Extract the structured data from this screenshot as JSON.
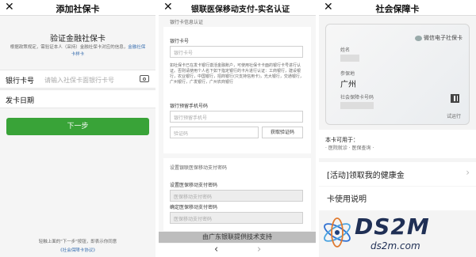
{
  "p1": {
    "title": "添加社保卡",
    "close": "✕",
    "heading": "验证金融社保卡",
    "desc": "根据政策规定，需验证本人（采持）金融社保卡对应的信息，",
    "link": "金融社保卡样卡",
    "card_label": "银行卡号",
    "card_placeholder": "请输入社保卡面银行卡号",
    "date_label": "发卡日期",
    "next": "下一步",
    "footer1": "轻触上面的\"下一步\"按钮，即表示你同意",
    "footer2": "《社会保障卡协议》"
  },
  "p2": {
    "title": "银联医保移动支付-实名认证",
    "s1": "银行卡信息认证",
    "f1": "银行卡号",
    "f1_ph": "银行卡号",
    "note": "如社保卡已在发卡银行激活金融账户，可使用社保卡卡面的银行卡号进行认证。否则请使用个人名下如下指定银行的卡片进行认证：工商银行，建设银行，农业银行，中国银行，招商银行(只支持信用卡)，光大银行，交通银行，广州银行，广发银行，广州农商银行",
    "f2": "银行预留手机号码",
    "f2_ph": "银行预留手机号",
    "code_ph": "验证码",
    "code_btn": "获取验证码",
    "s2": "设置银联医保移动支付密码",
    "f3": "设置医保移动支付密码",
    "f3_ph": "医保移动支付密码",
    "f4": "确定医保移动支付密码",
    "f4_ph": "医保移动支付密码",
    "banner": "由广东银联提供技术支持",
    "back": "‹",
    "fwd": "›"
  },
  "p3": {
    "title": "社会保障卡",
    "close": "✕",
    "card_brand": "微信电子社保卡",
    "name_lbl": "姓名",
    "place_lbl": "参保地",
    "place": "广州",
    "number_lbl": "社会保障卡号码",
    "status": "试运行",
    "use_label": "本卡可用于：",
    "uses": "· 医院就诊 · 医保查询 ·",
    "promo": "[活动]领取我的健康金",
    "guide": "卡使用说明"
  },
  "watermark": {
    "logo": "DS2M",
    "url": "ds2m.com"
  },
  "colors": {
    "accent": "#39a338",
    "link": "#3a6fb0"
  }
}
